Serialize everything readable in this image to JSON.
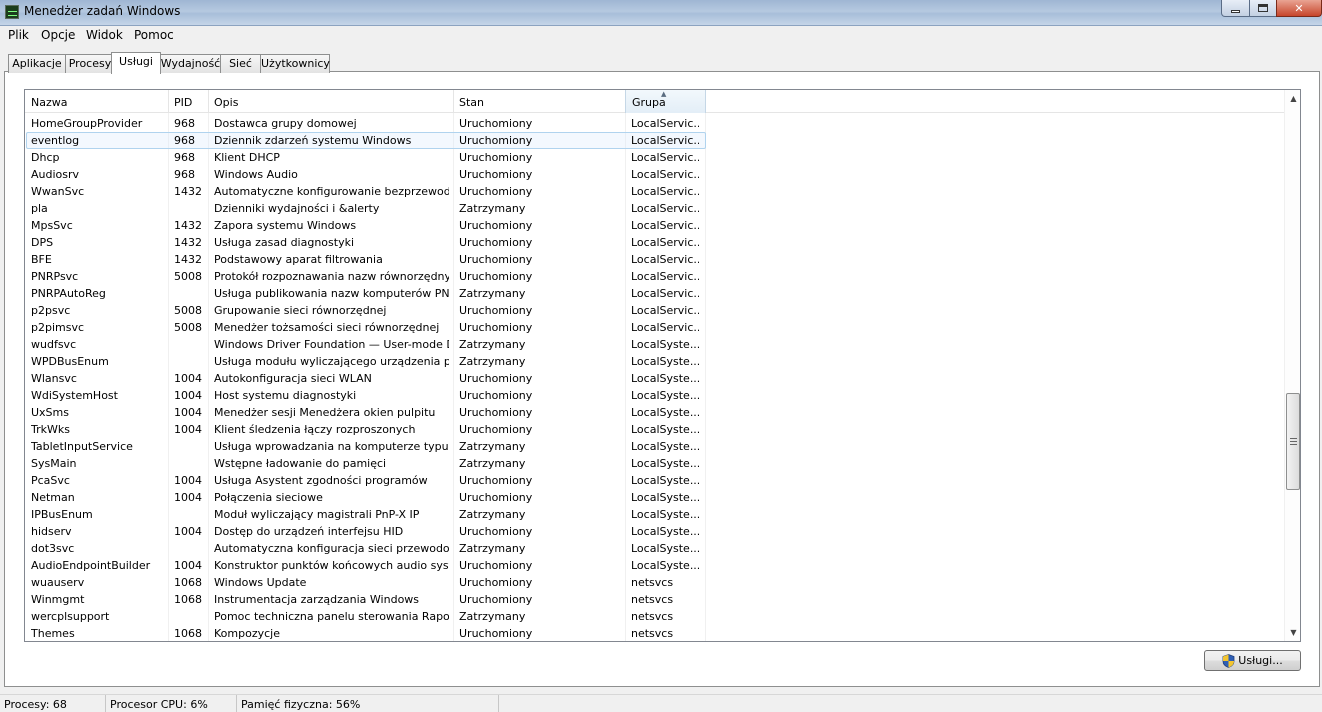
{
  "window": {
    "title": "Menedżer zadań Windows"
  },
  "menu": [
    "Plik",
    "Opcje",
    "Widok",
    "Pomoc"
  ],
  "tabs": [
    {
      "label": "Aplikacje",
      "active": false
    },
    {
      "label": "Procesy",
      "active": false
    },
    {
      "label": "Usługi",
      "active": true
    },
    {
      "label": "Wydajność",
      "active": false
    },
    {
      "label": "Sieć",
      "active": false
    },
    {
      "label": "Użytkownicy",
      "active": false
    }
  ],
  "columns": {
    "name": "Nazwa",
    "pid": "PID",
    "desc": "Opis",
    "status": "Stan",
    "group": "Grupa"
  },
  "sort": {
    "column": "group",
    "direction": "ascending"
  },
  "selected_index": 1,
  "services": [
    {
      "name": "HomeGroupProvider",
      "pid": "968",
      "desc": "Dostawca grupy domowej",
      "status": "Uruchomiony",
      "group": "LocalServic..."
    },
    {
      "name": "eventlog",
      "pid": "968",
      "desc": "Dziennik zdarzeń systemu Windows",
      "status": "Uruchomiony",
      "group": "LocalServic..."
    },
    {
      "name": "Dhcp",
      "pid": "968",
      "desc": "Klient DHCP",
      "status": "Uruchomiony",
      "group": "LocalServic..."
    },
    {
      "name": "Audiosrv",
      "pid": "968",
      "desc": "Windows Audio",
      "status": "Uruchomiony",
      "group": "LocalServic..."
    },
    {
      "name": "WwanSvc",
      "pid": "1432",
      "desc": "Automatyczne konfigurowanie bezprzewodo...",
      "status": "Uruchomiony",
      "group": "LocalServic..."
    },
    {
      "name": "pla",
      "pid": "",
      "desc": "Dzienniki wydajności i &alerty",
      "status": "Zatrzymany",
      "group": "LocalServic..."
    },
    {
      "name": "MpsSvc",
      "pid": "1432",
      "desc": "Zapora systemu Windows",
      "status": "Uruchomiony",
      "group": "LocalServic..."
    },
    {
      "name": "DPS",
      "pid": "1432",
      "desc": "Usługa zasad diagnostyki",
      "status": "Uruchomiony",
      "group": "LocalServic..."
    },
    {
      "name": "BFE",
      "pid": "1432",
      "desc": "Podstawowy aparat filtrowania",
      "status": "Uruchomiony",
      "group": "LocalServic..."
    },
    {
      "name": "PNRPsvc",
      "pid": "5008",
      "desc": "Protokół rozpoznawania nazw równorzędnych",
      "status": "Uruchomiony",
      "group": "LocalServic..."
    },
    {
      "name": "PNRPAutoReg",
      "pid": "",
      "desc": "Usługa publikowania nazw komputerów PNRP",
      "status": "Zatrzymany",
      "group": "LocalServic..."
    },
    {
      "name": "p2psvc",
      "pid": "5008",
      "desc": "Grupowanie sieci równorzędnej",
      "status": "Uruchomiony",
      "group": "LocalServic..."
    },
    {
      "name": "p2pimsvc",
      "pid": "5008",
      "desc": "Menedżer tożsamości sieci równorzędnej",
      "status": "Uruchomiony",
      "group": "LocalServic..."
    },
    {
      "name": "wudfsvc",
      "pid": "",
      "desc": "Windows Driver Foundation — User-mode Dri...",
      "status": "Zatrzymany",
      "group": "LocalSyste..."
    },
    {
      "name": "WPDBusEnum",
      "pid": "",
      "desc": "Usługa modułu wyliczającego urządzenia prze...",
      "status": "Zatrzymany",
      "group": "LocalSyste..."
    },
    {
      "name": "Wlansvc",
      "pid": "1004",
      "desc": "Autokonfiguracja sieci WLAN",
      "status": "Uruchomiony",
      "group": "LocalSyste..."
    },
    {
      "name": "WdiSystemHost",
      "pid": "1004",
      "desc": "Host systemu diagnostyki",
      "status": "Uruchomiony",
      "group": "LocalSyste..."
    },
    {
      "name": "UxSms",
      "pid": "1004",
      "desc": "Menedżer sesji Menedżera okien pulpitu",
      "status": "Uruchomiony",
      "group": "LocalSyste..."
    },
    {
      "name": "TrkWks",
      "pid": "1004",
      "desc": "Klient śledzenia łączy rozproszonych",
      "status": "Uruchomiony",
      "group": "LocalSyste..."
    },
    {
      "name": "TabletInputService",
      "pid": "",
      "desc": "Usługa wprowadzania na komputerze typu Ta...",
      "status": "Zatrzymany",
      "group": "LocalSyste..."
    },
    {
      "name": "SysMain",
      "pid": "",
      "desc": "Wstępne ładowanie do pamięci",
      "status": "Zatrzymany",
      "group": "LocalSyste..."
    },
    {
      "name": "PcaSvc",
      "pid": "1004",
      "desc": "Usługa Asystent zgodności programów",
      "status": "Uruchomiony",
      "group": "LocalSyste..."
    },
    {
      "name": "Netman",
      "pid": "1004",
      "desc": "Połączenia sieciowe",
      "status": "Uruchomiony",
      "group": "LocalSyste..."
    },
    {
      "name": "IPBusEnum",
      "pid": "",
      "desc": "Moduł wyliczający magistrali PnP-X IP",
      "status": "Zatrzymany",
      "group": "LocalSyste..."
    },
    {
      "name": "hidserv",
      "pid": "1004",
      "desc": "Dostęp do urządzeń interfejsu HID",
      "status": "Uruchomiony",
      "group": "LocalSyste..."
    },
    {
      "name": "dot3svc",
      "pid": "",
      "desc": "Automatyczna konfiguracja sieci przewodowej",
      "status": "Zatrzymany",
      "group": "LocalSyste..."
    },
    {
      "name": "AudioEndpointBuilder",
      "pid": "1004",
      "desc": "Konstruktor punktów końcowych audio syste...",
      "status": "Uruchomiony",
      "group": "LocalSyste..."
    },
    {
      "name": "wuauserv",
      "pid": "1068",
      "desc": "Windows Update",
      "status": "Uruchomiony",
      "group": "netsvcs"
    },
    {
      "name": "Winmgmt",
      "pid": "1068",
      "desc": "Instrumentacja zarządzania Windows",
      "status": "Uruchomiony",
      "group": "netsvcs"
    },
    {
      "name": "wercplsupport",
      "pid": "",
      "desc": "Pomoc techniczna panelu sterowania Raporty...",
      "status": "Zatrzymany",
      "group": "netsvcs"
    },
    {
      "name": "Themes",
      "pid": "1068",
      "desc": "Kompozycje",
      "status": "Uruchomiony",
      "group": "netsvcs"
    }
  ],
  "services_button": {
    "label": "Usługi..."
  },
  "statusbar": {
    "processes": "Procesy: 68",
    "cpu": "Procesor CPU: 6%",
    "memory": "Pamięć fizyczna: 56%"
  }
}
